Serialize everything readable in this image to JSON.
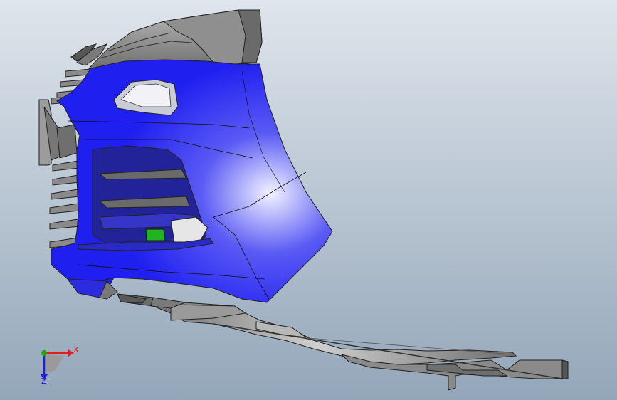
{
  "viewport": {
    "background_top": "#dfe5ec",
    "background_bottom": "#93a6b9",
    "model": {
      "body_color": "#1f1ff0",
      "body_highlight": "#f2f3ff",
      "part_color": "#8c8c8c",
      "part_dark": "#5a5a5a",
      "accent_color": "#21b321",
      "edge_color": "#222222"
    }
  },
  "triad": {
    "x_label": "X",
    "z_label": "Z",
    "x_color": "#e02020",
    "y_color": "#18a818",
    "z_color": "#2020d8",
    "base_color": "#9a9a9a"
  }
}
